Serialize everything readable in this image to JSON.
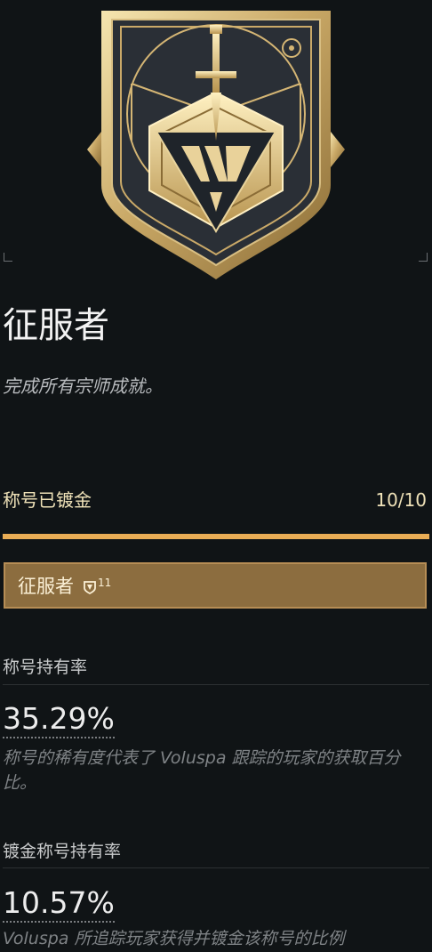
{
  "title": {
    "name": "征服者",
    "description": "完成所有宗师成就。"
  },
  "gilding": {
    "label": "称号已镀金",
    "count": "10/10",
    "progress_fraction": 1.0,
    "gilded_title": "征服者",
    "gild_level": "11"
  },
  "rarity": {
    "label": "称号持有率",
    "percent": "35.29%",
    "note": "称号的稀有度代表了 Voluspa 跟踪的玩家的获取百分比。"
  },
  "gilded_rarity": {
    "label": "镀金称号持有率",
    "percent": "10.57%",
    "note": "Voluspa 所追踪玩家获得并镀金该称号的比例"
  },
  "colors": {
    "background": "#101416",
    "progress_accent": "#e9ad55",
    "gilded_box": "#8c6d3f",
    "gold_text": "#efe2b8"
  },
  "icons": {
    "emblem": "conqueror-seal-icon",
    "gild_badge": "gilded-seal-icon"
  }
}
